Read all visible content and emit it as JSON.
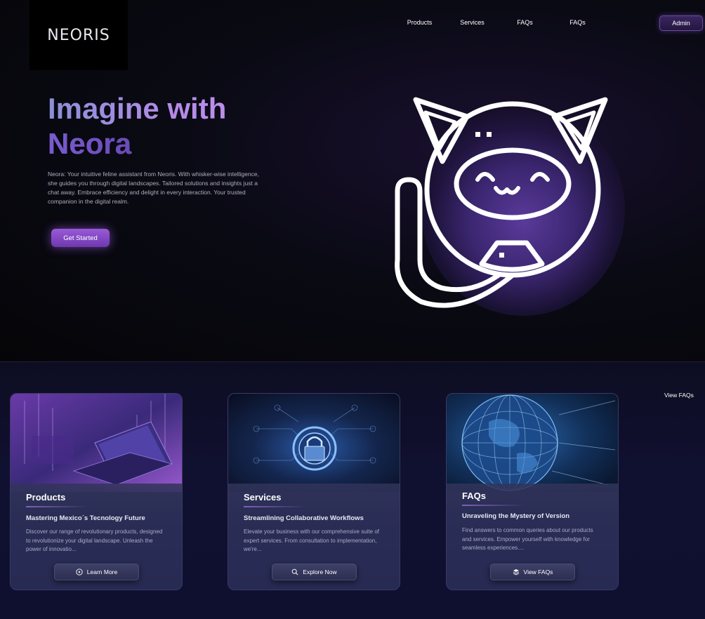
{
  "brand": {
    "logo": "NEORIS"
  },
  "nav": {
    "items": [
      "Products",
      "Services",
      "FAQs",
      "FAQs"
    ],
    "admin_label": "Admin"
  },
  "hero": {
    "title_line1": "Imagine with",
    "title_line2": "Neora",
    "description": "Neora: Your intuitive feline assistant from Neoris. With whisker-wise intelligence, she guides you through digital landscapes. Tailored solutions and insights just a chat away. Embrace efficiency and delight in every interaction. Your trusted companion in the digital realm.",
    "cta_label": "Get Started",
    "mascot_icon": "cat-robot-icon"
  },
  "view_faqs_link": "View FAQs",
  "cards": [
    {
      "title": "Products",
      "subtitle": "Mastering Mexico´s Tecnology Future",
      "description": "Discover our range of revolutionary products, designed to revolutionize your digital landscape. Unleash the power of innovatio...",
      "button_label": "Learn More",
      "button_icon": "play-icon"
    },
    {
      "title": "Services",
      "subtitle": "Streamlining Collaborative Workflows",
      "description": "Elevate your business with our comprehensive suite of expert services. From consultation to implementation, we're...",
      "button_label": "Explore Now",
      "button_icon": "search-icon"
    },
    {
      "title": "FAQs",
      "subtitle": "Unraveling the Mystery of Version",
      "description": "Find answers to common queries about our products and services. Empower yourself with knowledge for seamless experiences....",
      "button_label": "View FAQs",
      "button_icon": "layers-icon"
    }
  ],
  "colors": {
    "accent": "#8a4fd0",
    "background": "#05050b",
    "card": "#272a52"
  }
}
